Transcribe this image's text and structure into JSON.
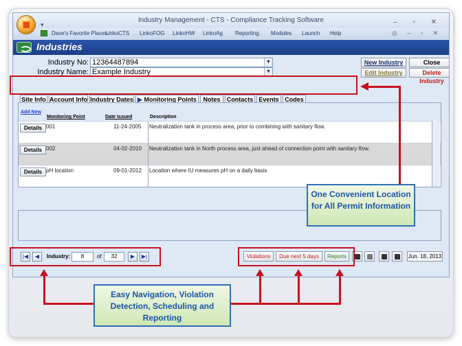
{
  "window": {
    "title": "Industry Management - CTS - Compliance Tracking Software",
    "quick_access": "▾",
    "controls": "–  ▫  ✕",
    "menu_controls": "◎  –  ▫  ✕"
  },
  "menu": {
    "items": [
      "Dave's Favorite Places",
      "LinkoCTS",
      "LinkoFOG",
      "LinkoHW",
      "LinkoAg",
      "Reporting",
      "Modules",
      "Launch",
      "Help"
    ]
  },
  "header": {
    "title": "Industries"
  },
  "form": {
    "industry_no_label": "Industry No:",
    "industry_no_value": "12364487894",
    "industry_name_label": "Industry Name:",
    "industry_name_value": "Example Industry"
  },
  "actions": {
    "new_industry": "New Industry",
    "close": "Close",
    "edit_industry": "Edit Industry",
    "delete_industry": "Delete Industry"
  },
  "tabs": [
    "Site Info",
    "Account Info",
    "Industry Dates",
    "Monitoring Points",
    "Notes",
    "Contacts",
    "Events",
    "Codes"
  ],
  "tab_active_marker": "▶",
  "table": {
    "add_new": "Add New",
    "headers": [
      "Monitoring Point",
      "Date Issued",
      "Description"
    ],
    "details_label": "Details",
    "rows": [
      {
        "point": "001",
        "date": "11-24-2005",
        "desc": "Neutralization tank in process area, prior to combining with sanitary flow."
      },
      {
        "point": "002",
        "date": "04-02-2010",
        "desc": "Neutralization tank in North process area, just ahead of connection point with sanitary flow."
      },
      {
        "point": "pH location",
        "date": "09-01-2012",
        "desc": "Location where IU measures pH on a daily basis"
      }
    ]
  },
  "navigation": {
    "label": "Industry:",
    "current": "8",
    "of": "of",
    "total": "32"
  },
  "status_buttons": {
    "violations": "Violations",
    "due_next": "Due next 5 days",
    "reports": "Reports"
  },
  "date": "Jun. 18, 2013",
  "callouts": {
    "permit": "One Convenient Location for All Permit Information",
    "navigation": "Easy Navigation, Violation Detection, Scheduling and Reporting"
  }
}
